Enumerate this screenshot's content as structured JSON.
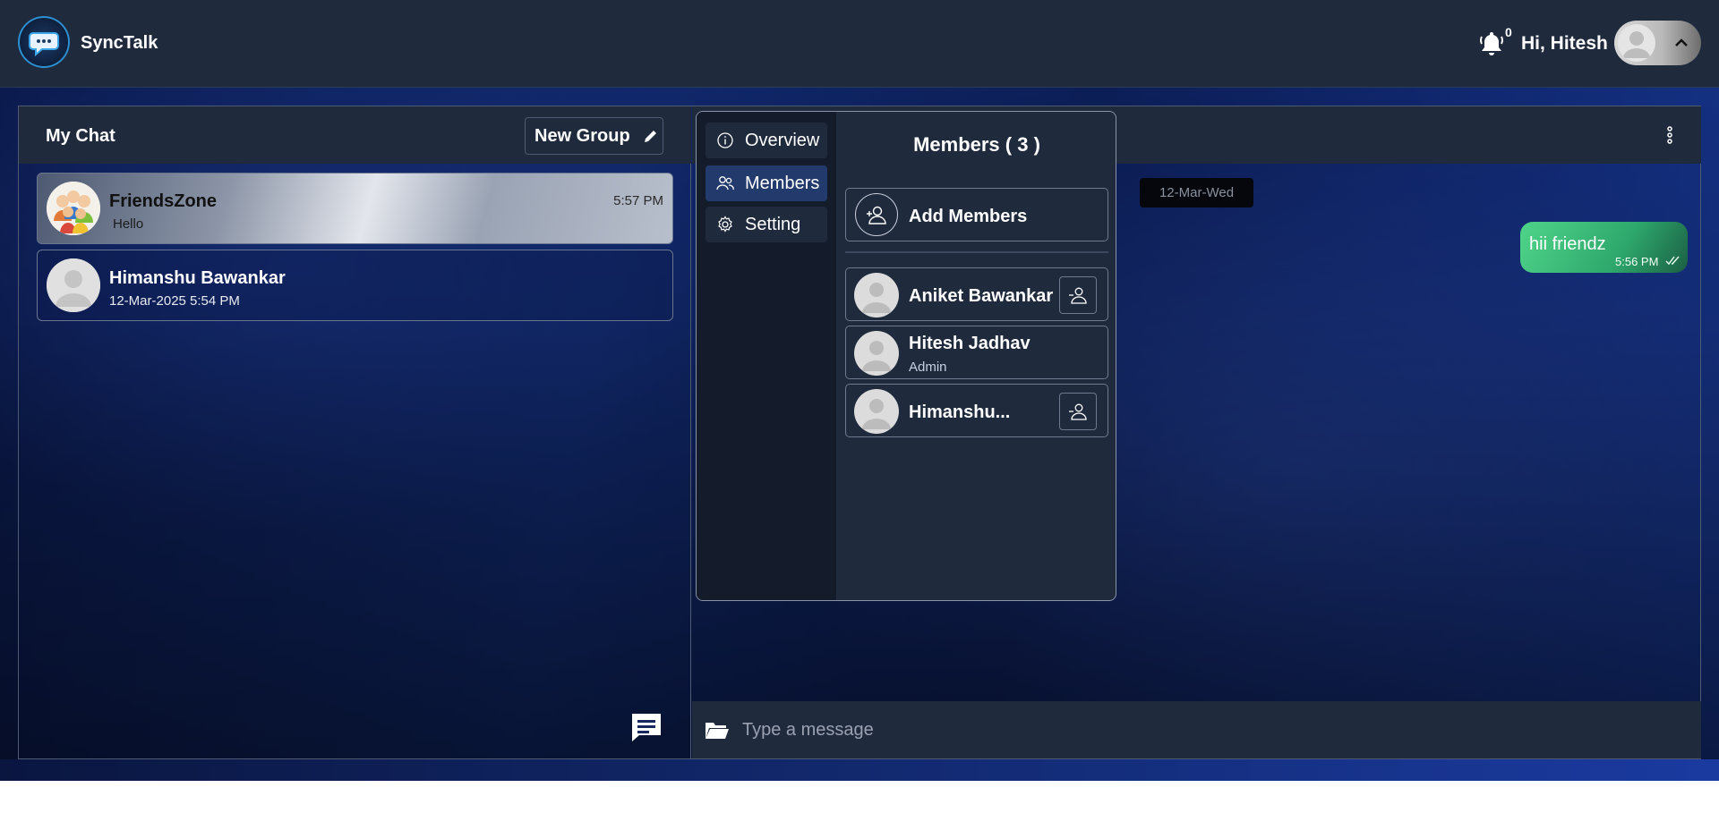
{
  "header": {
    "brand": "SyncTalk",
    "notification_count": "0",
    "greeting": "Hi, Hitesh"
  },
  "sidebar": {
    "title": "My Chat",
    "new_group_label": "New Group",
    "chats": [
      {
        "name": "FriendsZone",
        "preview": "Hello",
        "time": "5:57 PM",
        "active": true
      },
      {
        "name": "Himanshu Bawankar",
        "preview": "12-Mar-2025 5:54 PM",
        "active": false
      }
    ]
  },
  "conversation": {
    "date_chip": "12-Mar-Wed",
    "messages": [
      {
        "text": "hii friendz",
        "time": "5:56 PM",
        "status_icon": "double-check-icon"
      }
    ],
    "composer_placeholder": "Type a message"
  },
  "group_info": {
    "nav": [
      {
        "label": "Overview",
        "icon": "info-icon",
        "active": false
      },
      {
        "label": "Members",
        "icon": "users-icon",
        "active": true
      },
      {
        "label": "Setting",
        "icon": "gear-icon",
        "active": false
      }
    ],
    "members_title": "Members ( 3 )",
    "add_members_label": "Add Members",
    "members": [
      {
        "name": "Aniket Bawankar",
        "role": ""
      },
      {
        "name": "Hitesh Jadhav",
        "role": "Admin"
      },
      {
        "name": "Himanshu...",
        "role": ""
      }
    ]
  },
  "colors": {
    "header_bg": "#1f2a3d",
    "accent_blue": "#233a6c",
    "bubble_green": "#2ea86c"
  }
}
